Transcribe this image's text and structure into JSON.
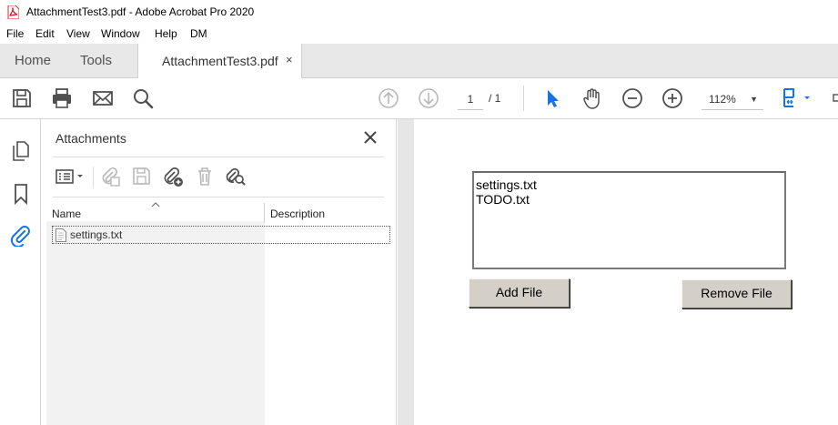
{
  "window": {
    "title": "AttachmentTest3.pdf - Adobe Acrobat Pro 2020"
  },
  "menu": [
    "File",
    "Edit",
    "View",
    "Window",
    "Help",
    "DM"
  ],
  "tabs": {
    "home": "Home",
    "tools": "Tools",
    "document": "AttachmentTest3.pdf",
    "close_glyph": "×"
  },
  "toolbar": {
    "page_current": "1",
    "page_total": "/ 1",
    "zoom": "112%"
  },
  "panel": {
    "title": "Attachments",
    "columns": {
      "name": "Name",
      "description": "Description"
    },
    "rows": [
      {
        "name": "settings.txt",
        "description": ""
      }
    ]
  },
  "document": {
    "listbox_items": [
      "settings.txt",
      "TODO.txt"
    ],
    "add_button": "Add File",
    "remove_button": "Remove File"
  },
  "colors": {
    "accent": "#1473e6",
    "icon": "#505050",
    "disabled": "#b8b8b8"
  }
}
